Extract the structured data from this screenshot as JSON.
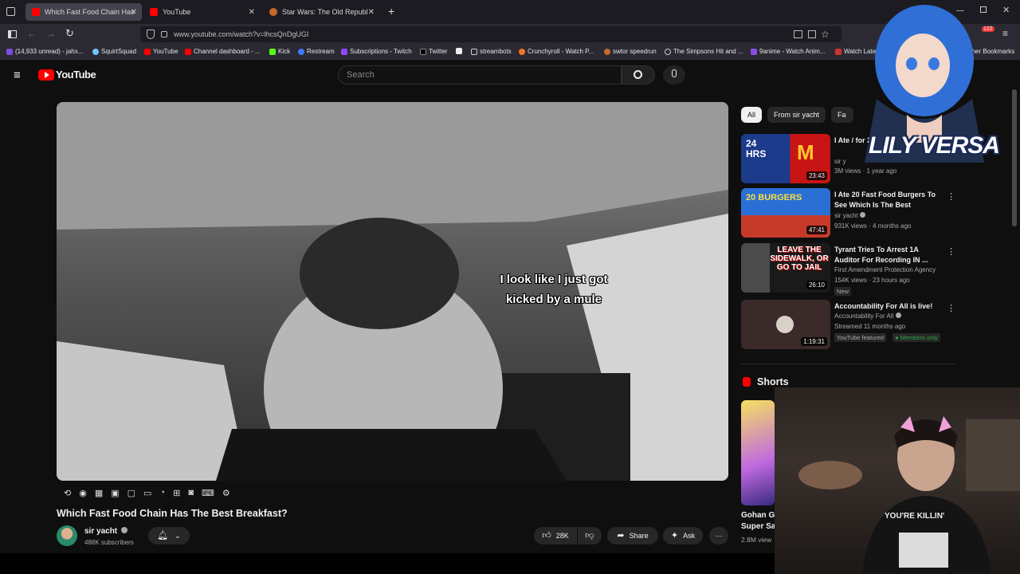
{
  "browser": {
    "tabs": [
      {
        "title": "Which Fast Food Chain Has",
        "active": true
      },
      {
        "title": "YouTube",
        "active": false
      },
      {
        "title": "Star Wars: The Old Republic - S",
        "active": false
      }
    ],
    "new_tab": "+",
    "url": "www.youtube.com/watch?v=lhcsQnDgUGI",
    "bookmarks": [
      "(14,933 unread) - jahx...",
      "SquirtSquad",
      "YouTube",
      "Channel dashboard - ...",
      "Kick",
      "Restream",
      "Subscriptions - Twitch",
      "Twitter",
      "streambots",
      "Crunchyroll - Watch P...",
      "swtor speedrun",
      "The Simpsons Hit and ...",
      "9anime - Watch Anim...",
      "Watch Latest"
    ],
    "other_bookmarks": "Other Bookmarks",
    "extension_count": "122"
  },
  "youtube": {
    "logo": "YouTube",
    "search_placeholder": "Search",
    "video": {
      "caption_line1": "I look like I just got",
      "caption_line2": "kicked by a mule",
      "title": "Which Fast Food Chain Has The Best Breakfast?",
      "channel": "sir yacht",
      "subscribers": "488K subscribers",
      "likes": "28K",
      "share": "Share",
      "ask": "Ask"
    },
    "chips": [
      "All",
      "From sir yacht",
      "Fa"
    ],
    "recommendations": [
      {
        "title": "I Ate / for 2",
        "channel": "sir y",
        "meta": "3M views · 1 year ago",
        "duration": "23:43",
        "thumb_text": "24 HRS"
      },
      {
        "title": "I Ate 20 Fast Food Burgers To See Which Is The Best",
        "channel": "sir yacht",
        "meta": "931K views · 4 months ago",
        "duration": "47:41",
        "thumb_text": "20 BURGERS"
      },
      {
        "title": "Tyrant Tries To Arrest 1A Auditor For Recording IN ...",
        "channel": "First Amendment Protection Agency",
        "meta": "154K views · 23 hours ago",
        "duration": "26:10",
        "badge": "New",
        "thumb_text": "LEAVE THE SIDEWALK, OR GO TO JAIL"
      },
      {
        "title": "Accountability For All is live!",
        "channel": "Accountability For All",
        "meta": "Streamed 11 months ago",
        "duration": "1:19:31",
        "badge": "YouTube featured",
        "badge2": "Members only"
      }
    ],
    "shorts_label": "Shorts",
    "short_title_1": "Gohan Go",
    "short_title_2": "Super Sa",
    "short_views": "2.8M view"
  },
  "overlay": {
    "brand": "LILY VERSA",
    "shirt_text": "YOU'RE KILLIN'"
  },
  "colors": {
    "accent": "#ff0000",
    "members": "#2ba640"
  }
}
